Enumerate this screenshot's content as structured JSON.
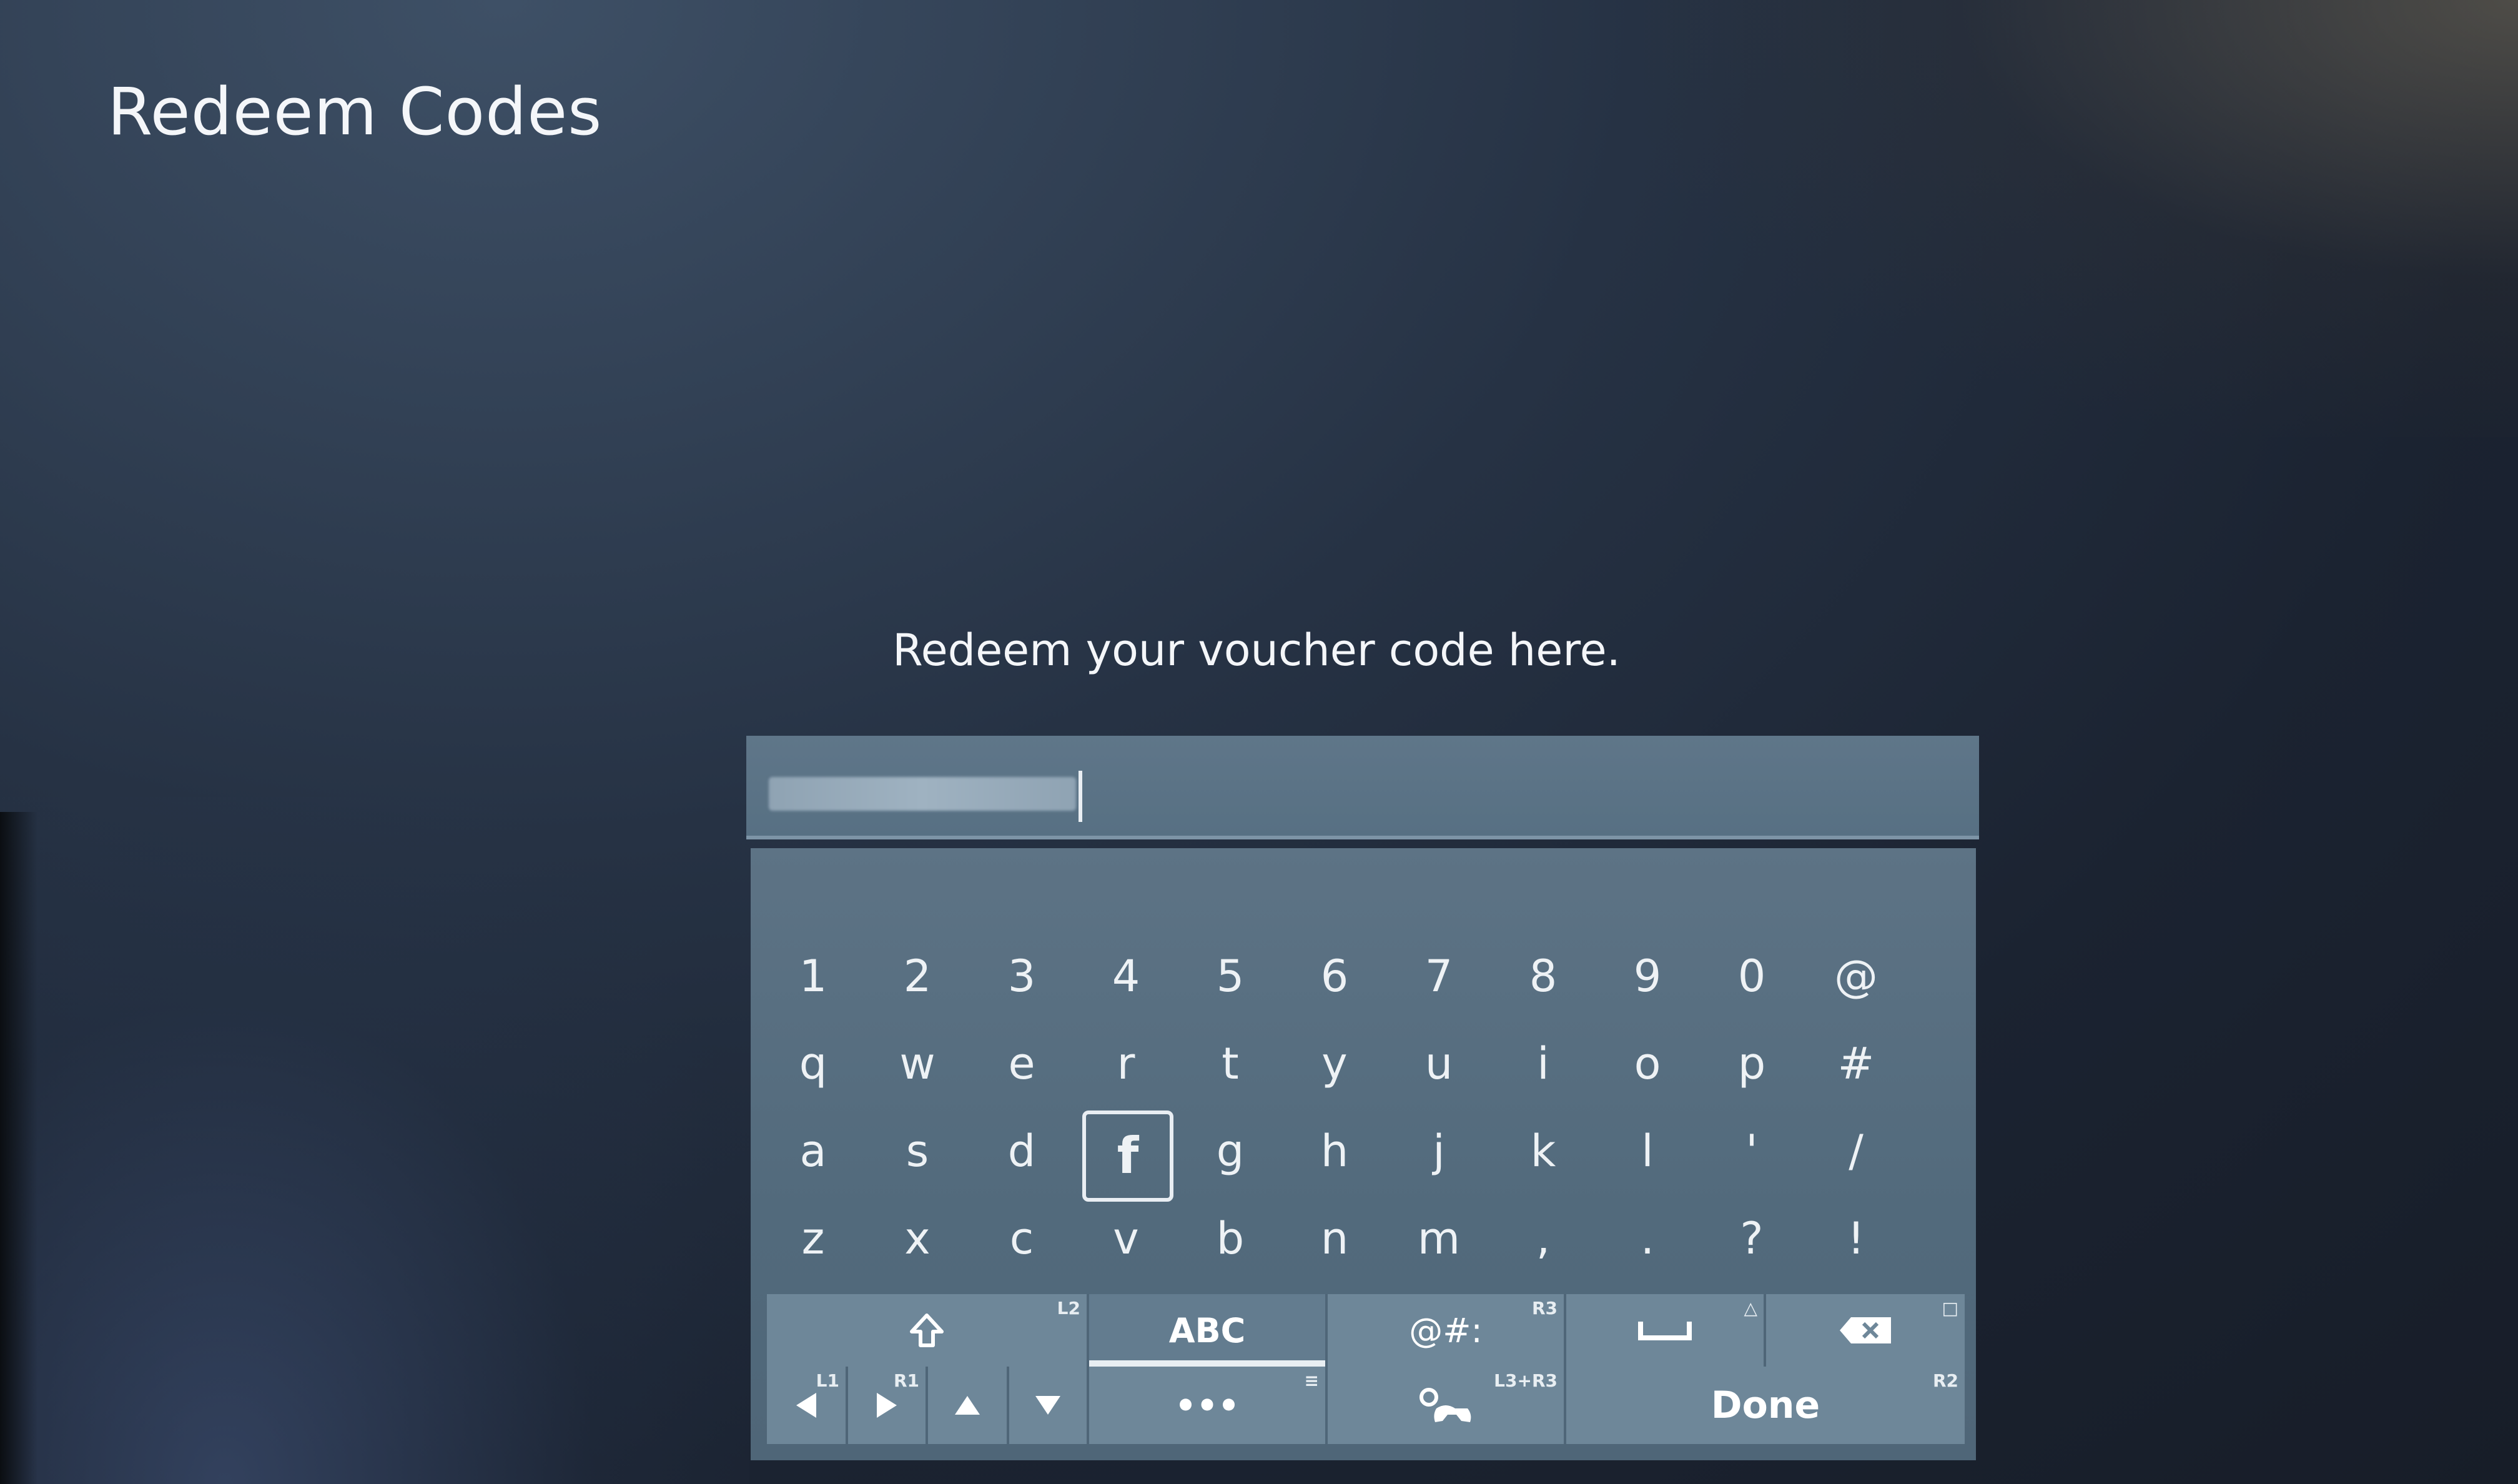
{
  "header": {
    "title": "Redeem Codes"
  },
  "prompt": "Redeem your voucher code here.",
  "keyboard": {
    "rows": [
      [
        "1",
        "2",
        "3",
        "4",
        "5",
        "6",
        "7",
        "8",
        "9",
        "0",
        "@"
      ],
      [
        "q",
        "w",
        "e",
        "r",
        "t",
        "y",
        "u",
        "i",
        "o",
        "p",
        "#"
      ],
      [
        "a",
        "s",
        "d",
        "f",
        "g",
        "h",
        "j",
        "k",
        "l",
        "'",
        "/"
      ],
      [
        "z",
        "x",
        "c",
        "v",
        "b",
        "n",
        "m",
        ",",
        ".",
        "?",
        "!"
      ]
    ],
    "selected_key": "f",
    "controls": {
      "shift_tag": "L2",
      "abc_label": "ABC",
      "symbols_label": "@#:",
      "symbols_tag": "R3",
      "space_tag": "△",
      "backspace_tag": "□",
      "left_tag": "L1",
      "right_tag": "R1",
      "more_label": "•••",
      "more_tag": "≡",
      "gamepad_tag": "L3+R3",
      "done_label": "Done",
      "done_tag": "R2"
    }
  },
  "icons": [
    "shift-icon",
    "space-icon",
    "backspace-icon",
    "arrow-left-icon",
    "arrow-right-icon",
    "arrow-up-icon",
    "arrow-down-icon",
    "gamepad-icon"
  ]
}
